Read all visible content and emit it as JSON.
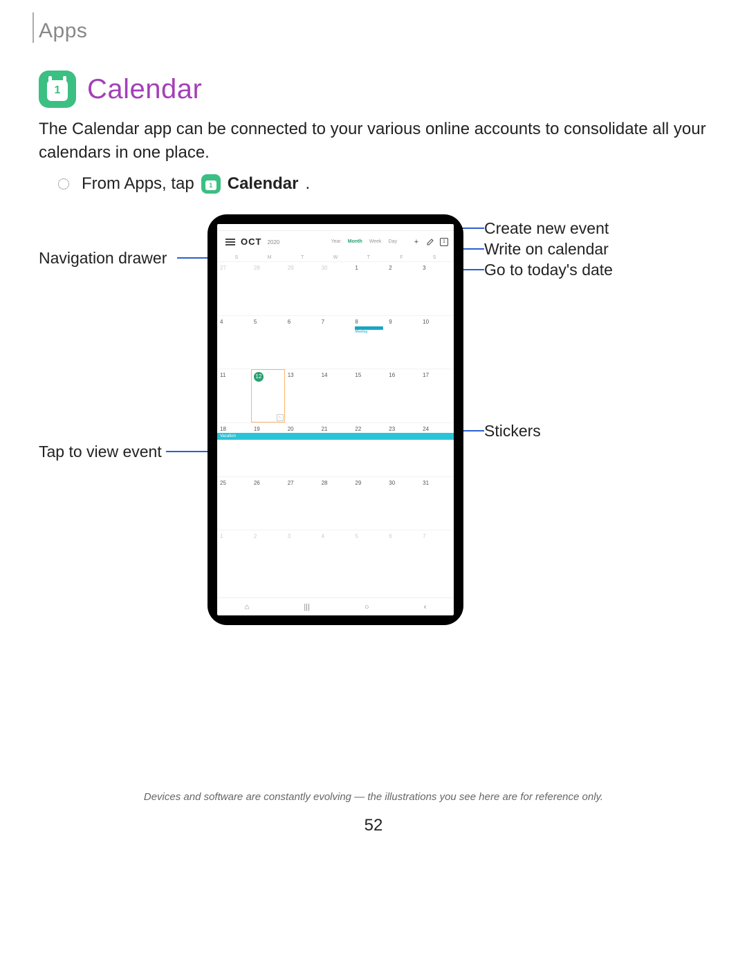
{
  "header": {
    "section": "Apps"
  },
  "title": {
    "icon_text": "1",
    "text": "Calendar"
  },
  "intro": "The Calendar app can be connected to your various online accounts to consolidate all your calendars in one place.",
  "step": {
    "prefix": "From Apps, tap",
    "icon_text": "1",
    "suffix": "Calendar",
    "period": "."
  },
  "figure": {
    "month": "OCT",
    "year": "2020",
    "views": {
      "year": "Year",
      "month": "Month",
      "week": "Week",
      "day": "Day"
    },
    "icons": {
      "plus": "+",
      "today": "1"
    },
    "weekdays": [
      "S",
      "M",
      "T",
      "W",
      "T",
      "F",
      "S"
    ],
    "prev_tail": [
      "27",
      "28",
      "29",
      "30"
    ],
    "days": [
      "1",
      "2",
      "3",
      "4",
      "5",
      "6",
      "7",
      "8",
      "9",
      "10",
      "11",
      "12",
      "13",
      "14",
      "15",
      "16",
      "17",
      "18",
      "19",
      "20",
      "21",
      "22",
      "23",
      "24",
      "25",
      "26",
      "27",
      "28",
      "29",
      "30",
      "31"
    ],
    "next_head": [
      "1",
      "2",
      "3",
      "4",
      "5",
      "6",
      "7"
    ],
    "today": "12",
    "meeting_label": "Meeting",
    "event_label": "Vacation",
    "nav": {
      "recents": "⌂",
      "menu": "|||",
      "home": "○",
      "back": "‹"
    }
  },
  "callouts": {
    "nav_drawer": "Navigation drawer",
    "tap_event": "Tap to view event",
    "create_event": "Create new event",
    "write_cal": "Write on calendar",
    "today_date": "Go to today's date",
    "stickers": "Stickers"
  },
  "footer": "Devices and software are constantly evolving — the illustrations you see here are for reference only.",
  "page_number": "52"
}
